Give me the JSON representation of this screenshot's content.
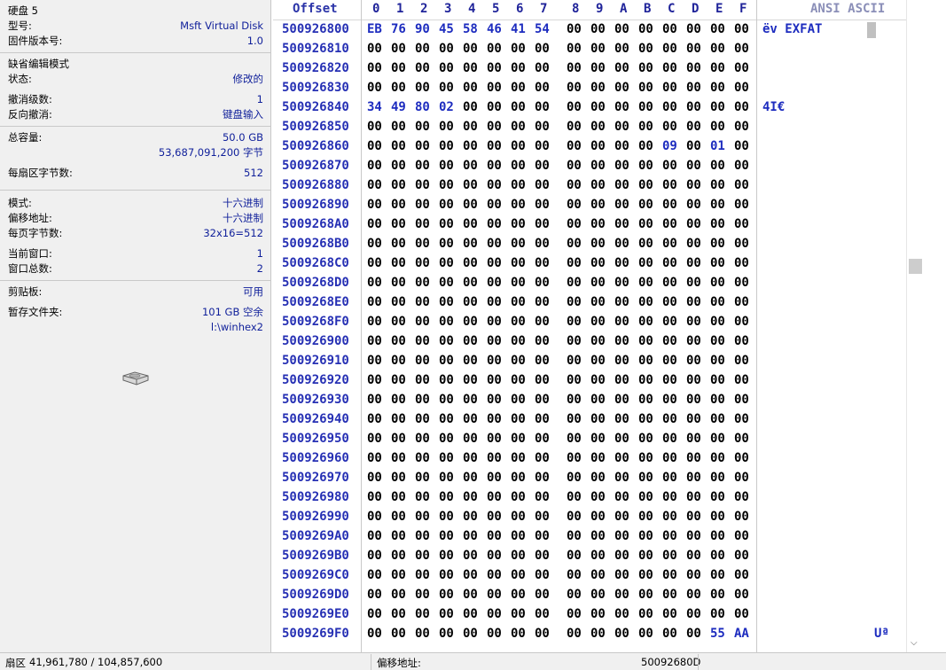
{
  "info": {
    "disk_title": "硬盘 5",
    "model_label": "型号:",
    "model_value": "Msft Virtual Disk",
    "firmware_label": "固件版本号:",
    "firmware_value": "1.0",
    "default_edit_mode": "缺省编辑模式",
    "state_label": "状态:",
    "state_value": "修改的",
    "undo_label": "撤消级数:",
    "undo_value": "1",
    "redo_label": "反向撤消:",
    "redo_value": "键盘输入",
    "capacity_label": "总容量:",
    "capacity_value": "50.0 GB",
    "capacity_bytes": "53,687,091,200 字节",
    "bps_label": "每扇区字节数:",
    "bps_value": "512",
    "mode_label": "模式:",
    "mode_value": "十六进制",
    "offset_label": "偏移地址:",
    "offset_value": "十六进制",
    "bpp_label": "每页字节数:",
    "bpp_value": "32x16=512",
    "curwin_label": "当前窗口:",
    "curwin_value": "1",
    "totalwin_label": "窗口总数:",
    "totalwin_value": "2",
    "clipboard_label": "剪贴板:",
    "clipboard_value": "可用",
    "temp_label": "暂存文件夹:",
    "temp_value": "101 GB 空余",
    "temp_path": "l:\\winhex2",
    "icon": "disk-icon"
  },
  "hex": {
    "offset_header": "Offset",
    "columns": [
      "0",
      "1",
      "2",
      "3",
      "4",
      "5",
      "6",
      "7",
      "8",
      "9",
      "A",
      "B",
      "C",
      "D",
      "E",
      "F"
    ],
    "ansi_header": "ANSI ASCII",
    "rows": [
      {
        "offset": "500926800",
        "bytes": [
          "EB",
          "76",
          "90",
          "45",
          "58",
          "46",
          "41",
          "54",
          "00",
          "00",
          "00",
          "00",
          "00",
          "00",
          "00",
          "00"
        ],
        "ascii": "ëv EXFAT"
      },
      {
        "offset": "500926810",
        "bytes": [
          "00",
          "00",
          "00",
          "00",
          "00",
          "00",
          "00",
          "00",
          "00",
          "00",
          "00",
          "00",
          "00",
          "00",
          "00",
          "00"
        ],
        "ascii": ""
      },
      {
        "offset": "500926820",
        "bytes": [
          "00",
          "00",
          "00",
          "00",
          "00",
          "00",
          "00",
          "00",
          "00",
          "00",
          "00",
          "00",
          "00",
          "00",
          "00",
          "00"
        ],
        "ascii": ""
      },
      {
        "offset": "500926830",
        "bytes": [
          "00",
          "00",
          "00",
          "00",
          "00",
          "00",
          "00",
          "00",
          "00",
          "00",
          "00",
          "00",
          "00",
          "00",
          "00",
          "00"
        ],
        "ascii": ""
      },
      {
        "offset": "500926840",
        "bytes": [
          "34",
          "49",
          "80",
          "02",
          "00",
          "00",
          "00",
          "00",
          "00",
          "00",
          "00",
          "00",
          "00",
          "00",
          "00",
          "00"
        ],
        "ascii": "4I€"
      },
      {
        "offset": "500926850",
        "bytes": [
          "00",
          "00",
          "00",
          "00",
          "00",
          "00",
          "00",
          "00",
          "00",
          "00",
          "00",
          "00",
          "00",
          "00",
          "00",
          "00"
        ],
        "ascii": ""
      },
      {
        "offset": "500926860",
        "bytes": [
          "00",
          "00",
          "00",
          "00",
          "00",
          "00",
          "00",
          "00",
          "00",
          "00",
          "00",
          "00",
          "09",
          "00",
          "01",
          "00"
        ],
        "ascii": ""
      },
      {
        "offset": "500926870",
        "bytes": [
          "00",
          "00",
          "00",
          "00",
          "00",
          "00",
          "00",
          "00",
          "00",
          "00",
          "00",
          "00",
          "00",
          "00",
          "00",
          "00"
        ],
        "ascii": ""
      },
      {
        "offset": "500926880",
        "bytes": [
          "00",
          "00",
          "00",
          "00",
          "00",
          "00",
          "00",
          "00",
          "00",
          "00",
          "00",
          "00",
          "00",
          "00",
          "00",
          "00"
        ],
        "ascii": ""
      },
      {
        "offset": "500926890",
        "bytes": [
          "00",
          "00",
          "00",
          "00",
          "00",
          "00",
          "00",
          "00",
          "00",
          "00",
          "00",
          "00",
          "00",
          "00",
          "00",
          "00"
        ],
        "ascii": ""
      },
      {
        "offset": "5009268A0",
        "bytes": [
          "00",
          "00",
          "00",
          "00",
          "00",
          "00",
          "00",
          "00",
          "00",
          "00",
          "00",
          "00",
          "00",
          "00",
          "00",
          "00"
        ],
        "ascii": ""
      },
      {
        "offset": "5009268B0",
        "bytes": [
          "00",
          "00",
          "00",
          "00",
          "00",
          "00",
          "00",
          "00",
          "00",
          "00",
          "00",
          "00",
          "00",
          "00",
          "00",
          "00"
        ],
        "ascii": ""
      },
      {
        "offset": "5009268C0",
        "bytes": [
          "00",
          "00",
          "00",
          "00",
          "00",
          "00",
          "00",
          "00",
          "00",
          "00",
          "00",
          "00",
          "00",
          "00",
          "00",
          "00"
        ],
        "ascii": ""
      },
      {
        "offset": "5009268D0",
        "bytes": [
          "00",
          "00",
          "00",
          "00",
          "00",
          "00",
          "00",
          "00",
          "00",
          "00",
          "00",
          "00",
          "00",
          "00",
          "00",
          "00"
        ],
        "ascii": ""
      },
      {
        "offset": "5009268E0",
        "bytes": [
          "00",
          "00",
          "00",
          "00",
          "00",
          "00",
          "00",
          "00",
          "00",
          "00",
          "00",
          "00",
          "00",
          "00",
          "00",
          "00"
        ],
        "ascii": ""
      },
      {
        "offset": "5009268F0",
        "bytes": [
          "00",
          "00",
          "00",
          "00",
          "00",
          "00",
          "00",
          "00",
          "00",
          "00",
          "00",
          "00",
          "00",
          "00",
          "00",
          "00"
        ],
        "ascii": ""
      },
      {
        "offset": "500926900",
        "bytes": [
          "00",
          "00",
          "00",
          "00",
          "00",
          "00",
          "00",
          "00",
          "00",
          "00",
          "00",
          "00",
          "00",
          "00",
          "00",
          "00"
        ],
        "ascii": ""
      },
      {
        "offset": "500926910",
        "bytes": [
          "00",
          "00",
          "00",
          "00",
          "00",
          "00",
          "00",
          "00",
          "00",
          "00",
          "00",
          "00",
          "00",
          "00",
          "00",
          "00"
        ],
        "ascii": ""
      },
      {
        "offset": "500926920",
        "bytes": [
          "00",
          "00",
          "00",
          "00",
          "00",
          "00",
          "00",
          "00",
          "00",
          "00",
          "00",
          "00",
          "00",
          "00",
          "00",
          "00"
        ],
        "ascii": ""
      },
      {
        "offset": "500926930",
        "bytes": [
          "00",
          "00",
          "00",
          "00",
          "00",
          "00",
          "00",
          "00",
          "00",
          "00",
          "00",
          "00",
          "00",
          "00",
          "00",
          "00"
        ],
        "ascii": ""
      },
      {
        "offset": "500926940",
        "bytes": [
          "00",
          "00",
          "00",
          "00",
          "00",
          "00",
          "00",
          "00",
          "00",
          "00",
          "00",
          "00",
          "00",
          "00",
          "00",
          "00"
        ],
        "ascii": ""
      },
      {
        "offset": "500926950",
        "bytes": [
          "00",
          "00",
          "00",
          "00",
          "00",
          "00",
          "00",
          "00",
          "00",
          "00",
          "00",
          "00",
          "00",
          "00",
          "00",
          "00"
        ],
        "ascii": ""
      },
      {
        "offset": "500926960",
        "bytes": [
          "00",
          "00",
          "00",
          "00",
          "00",
          "00",
          "00",
          "00",
          "00",
          "00",
          "00",
          "00",
          "00",
          "00",
          "00",
          "00"
        ],
        "ascii": ""
      },
      {
        "offset": "500926970",
        "bytes": [
          "00",
          "00",
          "00",
          "00",
          "00",
          "00",
          "00",
          "00",
          "00",
          "00",
          "00",
          "00",
          "00",
          "00",
          "00",
          "00"
        ],
        "ascii": ""
      },
      {
        "offset": "500926980",
        "bytes": [
          "00",
          "00",
          "00",
          "00",
          "00",
          "00",
          "00",
          "00",
          "00",
          "00",
          "00",
          "00",
          "00",
          "00",
          "00",
          "00"
        ],
        "ascii": ""
      },
      {
        "offset": "500926990",
        "bytes": [
          "00",
          "00",
          "00",
          "00",
          "00",
          "00",
          "00",
          "00",
          "00",
          "00",
          "00",
          "00",
          "00",
          "00",
          "00",
          "00"
        ],
        "ascii": ""
      },
      {
        "offset": "5009269A0",
        "bytes": [
          "00",
          "00",
          "00",
          "00",
          "00",
          "00",
          "00",
          "00",
          "00",
          "00",
          "00",
          "00",
          "00",
          "00",
          "00",
          "00"
        ],
        "ascii": ""
      },
      {
        "offset": "5009269B0",
        "bytes": [
          "00",
          "00",
          "00",
          "00",
          "00",
          "00",
          "00",
          "00",
          "00",
          "00",
          "00",
          "00",
          "00",
          "00",
          "00",
          "00"
        ],
        "ascii": ""
      },
      {
        "offset": "5009269C0",
        "bytes": [
          "00",
          "00",
          "00",
          "00",
          "00",
          "00",
          "00",
          "00",
          "00",
          "00",
          "00",
          "00",
          "00",
          "00",
          "00",
          "00"
        ],
        "ascii": ""
      },
      {
        "offset": "5009269D0",
        "bytes": [
          "00",
          "00",
          "00",
          "00",
          "00",
          "00",
          "00",
          "00",
          "00",
          "00",
          "00",
          "00",
          "00",
          "00",
          "00",
          "00"
        ],
        "ascii": ""
      },
      {
        "offset": "5009269E0",
        "bytes": [
          "00",
          "00",
          "00",
          "00",
          "00",
          "00",
          "00",
          "00",
          "00",
          "00",
          "00",
          "00",
          "00",
          "00",
          "00",
          "00"
        ],
        "ascii": ""
      },
      {
        "offset": "5009269F0",
        "bytes": [
          "00",
          "00",
          "00",
          "00",
          "00",
          "00",
          "00",
          "00",
          "00",
          "00",
          "00",
          "00",
          "00",
          "00",
          "55",
          "AA"
        ],
        "ascii": "Uª"
      }
    ]
  },
  "status": {
    "sector_label": "扇区",
    "sector_value": "41,961,780 / 104,857,600",
    "offset_label": "偏移地址:",
    "offset_value": "50092680D"
  }
}
